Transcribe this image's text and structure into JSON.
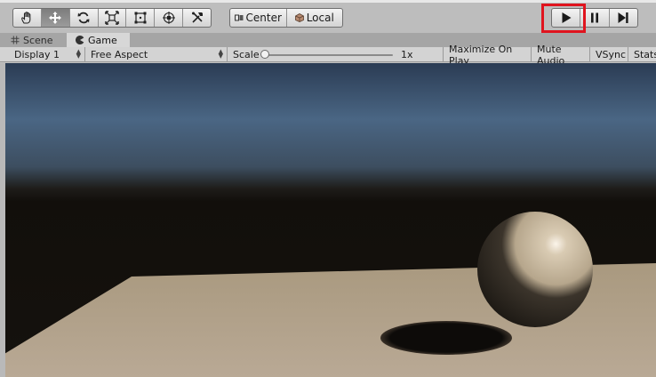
{
  "toolbar": {
    "tools": [
      {
        "icon": "hand-icon",
        "active": false
      },
      {
        "icon": "move-icon",
        "active": true
      },
      {
        "icon": "rotate-icon",
        "active": false
      },
      {
        "icon": "scale-icon",
        "active": false
      },
      {
        "icon": "rect-tool-icon",
        "active": false
      },
      {
        "icon": "transform-tool-icon",
        "active": false
      },
      {
        "icon": "custom-tool-icon",
        "active": false
      }
    ],
    "pivot_label": "Center",
    "rotation_label": "Local",
    "play_controls": [
      "play-icon",
      "pause-icon",
      "step-icon"
    ],
    "highlight_color": "#e0141e"
  },
  "tabs": {
    "scene": "Scene",
    "game": "Game"
  },
  "gamebar": {
    "display": "Display 1",
    "aspect": "Free Aspect",
    "scale_label": "Scale",
    "scale_value": "1x",
    "maximize": "Maximize On Play",
    "mute": "Mute Audio",
    "vsync": "VSync",
    "stats": "Stats"
  },
  "colors": {
    "sky_top": "#4a6684",
    "horizon": "#100f0d",
    "ground": "#b2a28f",
    "sphere": "#cdbfa8"
  }
}
